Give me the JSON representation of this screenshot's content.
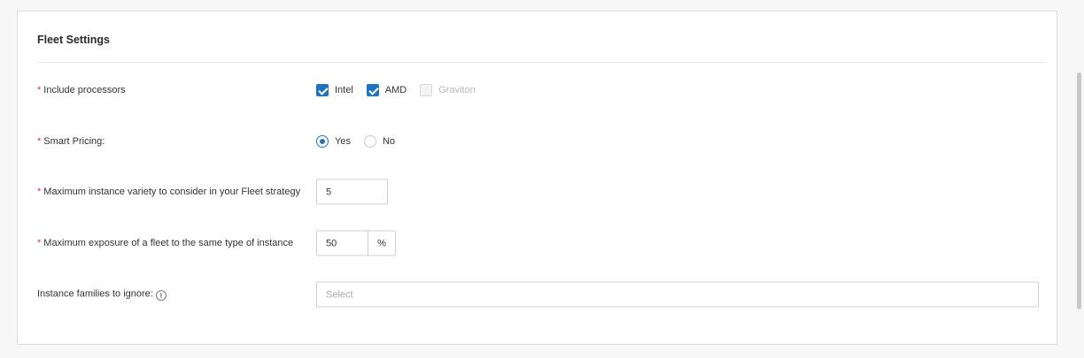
{
  "card": {
    "title": "Fleet Settings"
  },
  "required_mark": "*",
  "include_processors": {
    "label": "Include processors",
    "options": [
      {
        "label": "Intel",
        "checked": true,
        "disabled": false
      },
      {
        "label": "AMD",
        "checked": true,
        "disabled": false
      },
      {
        "label": "Graviton",
        "checked": false,
        "disabled": true
      }
    ]
  },
  "smart_pricing": {
    "label": "Smart Pricing:",
    "options": [
      {
        "label": "Yes",
        "selected": true
      },
      {
        "label": "No",
        "selected": false
      }
    ]
  },
  "max_variety": {
    "label": "Maximum instance variety to consider in your Fleet strategy",
    "value": "5"
  },
  "max_exposure": {
    "label": "Maximum exposure of a fleet to the same type of instance",
    "value": "50",
    "unit": "%"
  },
  "ignore_families": {
    "label": "Instance families to ignore:",
    "info_icon": "info-icon",
    "placeholder": "Select"
  },
  "colors": {
    "accent": "#1f74c0",
    "required": "#d9363e"
  }
}
